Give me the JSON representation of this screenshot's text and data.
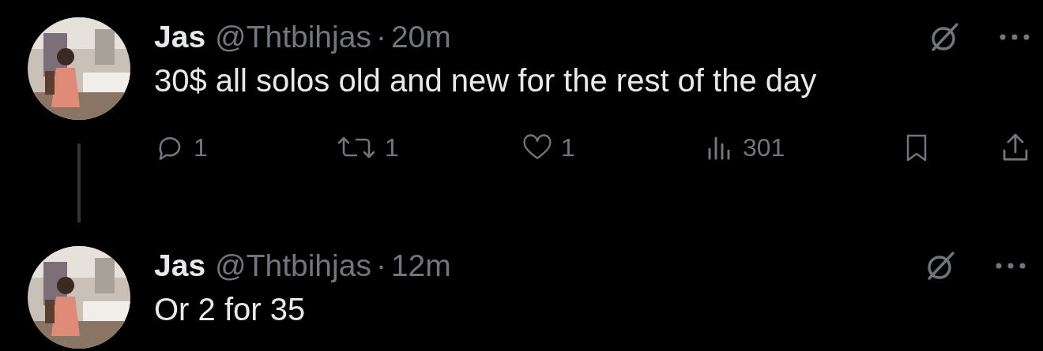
{
  "tweets": [
    {
      "name": "Jas",
      "handle": "@Thtbihjas",
      "separator": "·",
      "time": "20m",
      "text": "30$ all solos old and new for the rest of the day",
      "thread_line": true,
      "actions": [
        {
          "kind": "reply",
          "count": "1"
        },
        {
          "kind": "retweet",
          "count": "1"
        },
        {
          "kind": "like",
          "count": "1"
        },
        {
          "kind": "views",
          "count": "301"
        },
        {
          "kind": "bookmark"
        },
        {
          "kind": "share"
        }
      ]
    },
    {
      "name": "Jas",
      "handle": "@Thtbihjas",
      "separator": "·",
      "time": "12m",
      "text": "Or 2 for 35",
      "thread_line": false
    }
  ]
}
